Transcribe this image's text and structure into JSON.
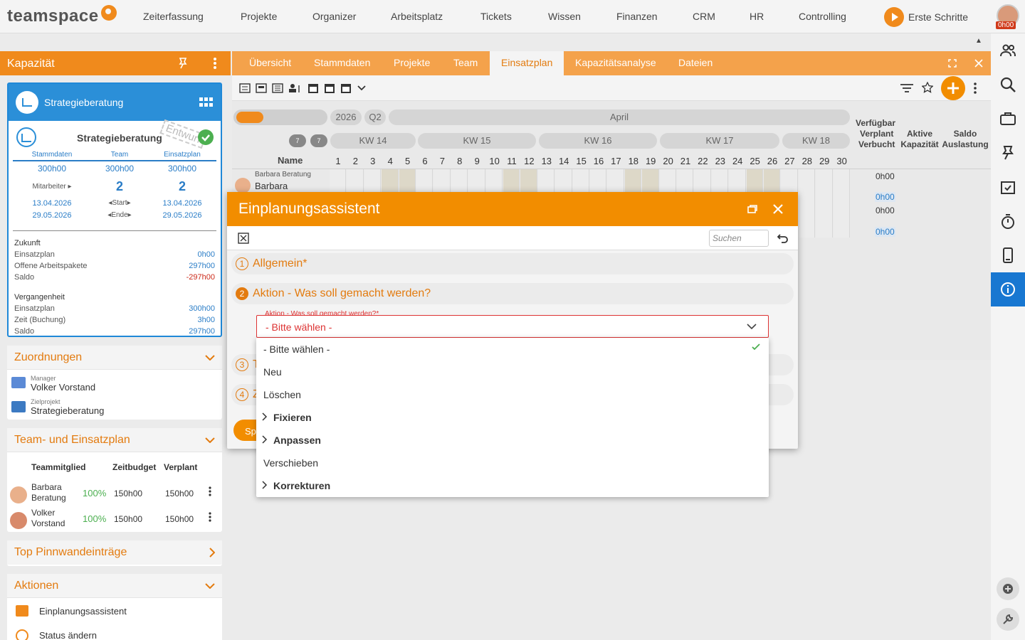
{
  "nav": {
    "logo": "teamspace",
    "items": [
      "Zeiterfassung",
      "Projekte",
      "Organizer",
      "Arbeitsplatz",
      "Tickets",
      "Wissen",
      "Finanzen",
      "CRM",
      "HR",
      "Controlling"
    ],
    "first_steps": "Erste Schritte",
    "time_badge": "0h00"
  },
  "left": {
    "title": "Kapazität",
    "project_name": "Strategieberatung",
    "project_subtitle": "Strategieberatung",
    "stamp": "Entwurf",
    "cols": [
      "Stammdaten",
      "Team",
      "Einsatzplan"
    ],
    "hours": [
      "300h00",
      "300h00",
      "300h00"
    ],
    "mitarbeiter_label": "Mitarbeiter",
    "mitarbeiter_vals": [
      "2",
      "2"
    ],
    "start_dates": [
      "13.04.2026",
      "13.04.2026"
    ],
    "start_label": "Start",
    "end_dates": [
      "29.05.2026",
      "29.05.2026"
    ],
    "end_label": "Ende",
    "zukunft_title": "Zukunft",
    "zukunft": [
      {
        "k": "Einsatzplan",
        "v": "0h00",
        "neg": false
      },
      {
        "k": "Offene Arbeitspakete",
        "v": "297h00",
        "neg": false
      },
      {
        "k": "Saldo",
        "v": "-297h00",
        "neg": true
      }
    ],
    "vergangenheit_title": "Vergangenheit",
    "vergangenheit": [
      {
        "k": "Einsatzplan",
        "v": "300h00"
      },
      {
        "k": "Zeit (Buchung)",
        "v": "3h00"
      },
      {
        "k": "Saldo",
        "v": "297h00"
      }
    ],
    "zuordnungen": {
      "title": "Zuordnungen",
      "manager_label": "Manager",
      "manager": "Volker Vorstand",
      "ziel_label": "Zielprojekt",
      "ziel": "Strategieberatung"
    },
    "team": {
      "title": "Team- und Einsatzplan",
      "headers": [
        "Teammitglied",
        "Zeitbudget",
        "Verplant"
      ],
      "rows": [
        {
          "name1": "Barbara",
          "name2": "Beratung",
          "pct": "100%",
          "budget": "150h00",
          "planned": "150h00"
        },
        {
          "name1": "Volker",
          "name2": "Vorstand",
          "pct": "100%",
          "budget": "150h00",
          "planned": "150h00"
        }
      ]
    },
    "pinnwand": "Top Pinnwandeinträge",
    "aktionen": {
      "title": "Aktionen",
      "items": [
        "Einplanungsassistent",
        "Status ändern"
      ]
    }
  },
  "tabs": [
    "Übersicht",
    "Stammdaten",
    "Projekte",
    "Team",
    "Einsatzplan",
    "Kapazitätsanalyse",
    "Dateien"
  ],
  "active_tab": "Einsatzplan",
  "plan": {
    "year": "2026",
    "quarter": "Q2",
    "month": "April",
    "weeks": [
      "KW 14",
      "KW 15",
      "KW 16",
      "KW 17",
      "KW 18"
    ],
    "name_header": "Name",
    "days": [
      "1",
      "2",
      "3",
      "4",
      "5",
      "6",
      "7",
      "8",
      "9",
      "10",
      "11",
      "12",
      "13",
      "14",
      "15",
      "16",
      "17",
      "18",
      "19",
      "20",
      "21",
      "22",
      "23",
      "24",
      "25",
      "26",
      "27",
      "28",
      "29",
      "30"
    ],
    "summary_headers": [
      "Verfügbar",
      "Verplant",
      "Verbucht",
      "Aktive Kapazität",
      "Saldo Auslastung"
    ],
    "row1_name_top": "Barbara Beratung",
    "row1_name": "Barbara",
    "values": [
      "0h00",
      "0h00",
      "0h00",
      "0h00"
    ],
    "mini_tags": [
      "7",
      "7"
    ]
  },
  "modal": {
    "title": "Einplanungsassistent",
    "search_placeholder": "Suchen",
    "sections": [
      {
        "num": "1",
        "label": "Allgemein*"
      },
      {
        "num": "2",
        "label": "Aktion - Was soll gemacht werden?"
      },
      {
        "num": "3",
        "label": "T"
      },
      {
        "num": "4",
        "label": "Z"
      }
    ],
    "field_label": "Aktion - Was soll gemacht werden?*",
    "field_value": "- Bitte wählen -",
    "submit_label": "Sp"
  },
  "dropdown": {
    "options": [
      {
        "label": "- Bitte wählen -",
        "group": false,
        "selected": true
      },
      {
        "label": "Neu",
        "group": false,
        "selected": false
      },
      {
        "label": "Löschen",
        "group": false,
        "selected": false
      },
      {
        "label": "Fixieren",
        "group": true,
        "selected": false
      },
      {
        "label": "Anpassen",
        "group": true,
        "selected": false
      },
      {
        "label": "Verschieben",
        "group": false,
        "selected": false
      },
      {
        "label": "Korrekturen",
        "group": true,
        "selected": false
      }
    ]
  },
  "colors": {
    "accent": "#f08a1c",
    "blue": "#1877d1",
    "error": "#d33333",
    "green": "#4caf50"
  }
}
